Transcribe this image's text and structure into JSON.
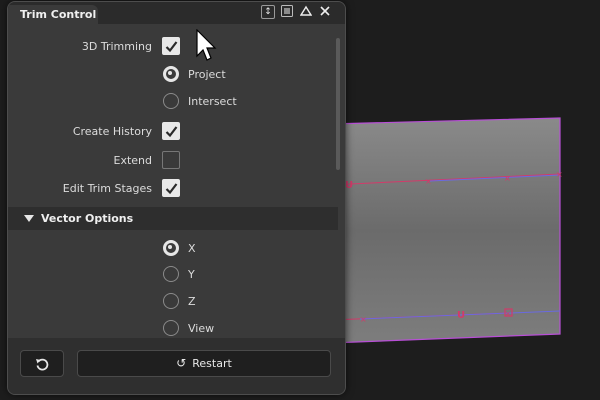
{
  "panel": {
    "title": "Trim Control",
    "titlebar_icons": [
      "expand-icon",
      "menu-icon",
      "collapse-icon",
      "close-icon"
    ]
  },
  "options": {
    "trimming_3d": {
      "label": "3D Trimming",
      "checked": true
    },
    "mode_project": {
      "label": "Project",
      "selected": true
    },
    "mode_intersect": {
      "label": "Intersect",
      "selected": false
    },
    "create_history": {
      "label": "Create History",
      "checked": true
    },
    "extend": {
      "label": "Extend",
      "checked": false
    },
    "edit_trim_stages": {
      "label": "Edit Trim Stages",
      "checked": true
    }
  },
  "vector_options": {
    "header": "Vector Options",
    "x": {
      "label": "X",
      "selected": true
    },
    "y": {
      "label": "Y",
      "selected": false
    },
    "z": {
      "label": "Z",
      "selected": false
    },
    "view": {
      "label": "View",
      "selected": false
    }
  },
  "footer": {
    "restart_label": "Restart"
  },
  "colors": {
    "panel_bg": "#3a3a3a",
    "surface_fill": "#7a7a7a",
    "surface_edge": "#b84fd6",
    "trim_curve": "#d33a6a"
  }
}
